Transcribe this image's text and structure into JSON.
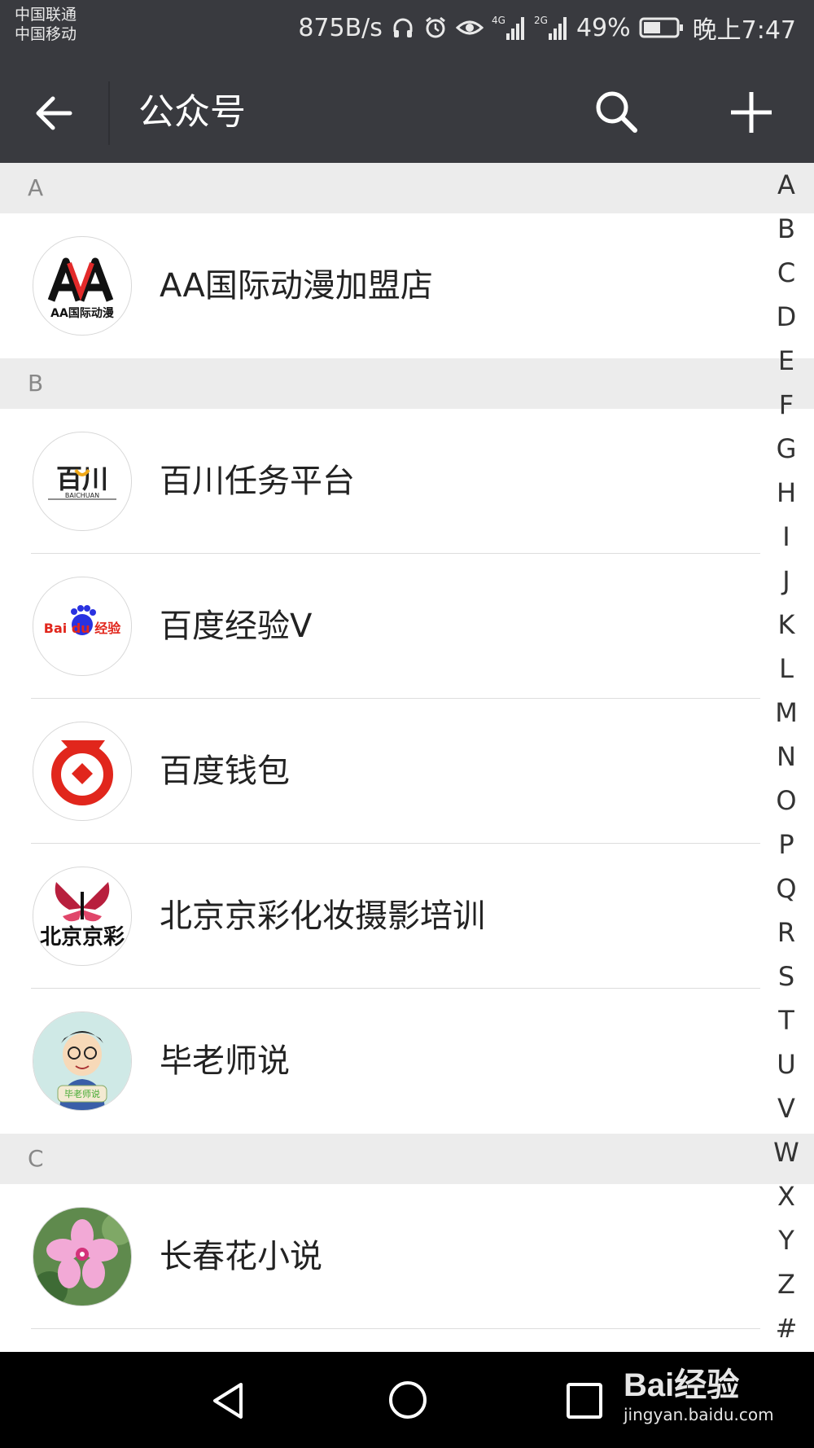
{
  "status_bar": {
    "carrier_1": "中国联通",
    "carrier_2": "中国移动",
    "speed": "875B/s",
    "battery": "49%",
    "time": "晚上7:47",
    "icons": [
      "headphones-icon",
      "alarm-icon",
      "eye-icon",
      "signal-4g-icon",
      "signal-2g-icon",
      "battery-icon"
    ]
  },
  "header": {
    "title": "公众号",
    "icons": [
      "back-arrow-icon",
      "search-icon",
      "plus-icon"
    ]
  },
  "sections": [
    {
      "letter": "A",
      "items": [
        {
          "name": "AA国际动漫加盟店",
          "avatar_text": "AA国际动漫"
        }
      ]
    },
    {
      "letter": "B",
      "items": [
        {
          "name": "百川任务平台",
          "avatar_text": "百川",
          "avatar_sub": "BAICHUAN"
        },
        {
          "name": "百度经验V",
          "avatar_text": "Bai du 经验"
        },
        {
          "name": "百度钱包",
          "avatar_text": ""
        },
        {
          "name": "北京京彩化妆摄影培训",
          "avatar_text": "北京京彩"
        },
        {
          "name": "毕老师说",
          "avatar_text": "毕老师说"
        }
      ]
    },
    {
      "letter": "C",
      "items": [
        {
          "name": "长春花小说",
          "avatar_text": ""
        }
      ]
    }
  ],
  "index_letters": [
    "A",
    "B",
    "C",
    "D",
    "E",
    "F",
    "G",
    "H",
    "I",
    "J",
    "K",
    "L",
    "M",
    "N",
    "O",
    "P",
    "Q",
    "R",
    "S",
    "T",
    "U",
    "V",
    "W",
    "X",
    "Y",
    "Z",
    "#"
  ],
  "navigation": {
    "icons": [
      "nav-back-icon",
      "nav-home-icon",
      "nav-recent-icon"
    ]
  },
  "watermark": {
    "main": "Bai经验",
    "sub": "jingyan.baidu.com"
  },
  "colors": {
    "header_bg": "#393a3f",
    "section_bg": "#ececec",
    "baidu_red": "#e1261c",
    "baidu_blue": "#2932e1"
  }
}
